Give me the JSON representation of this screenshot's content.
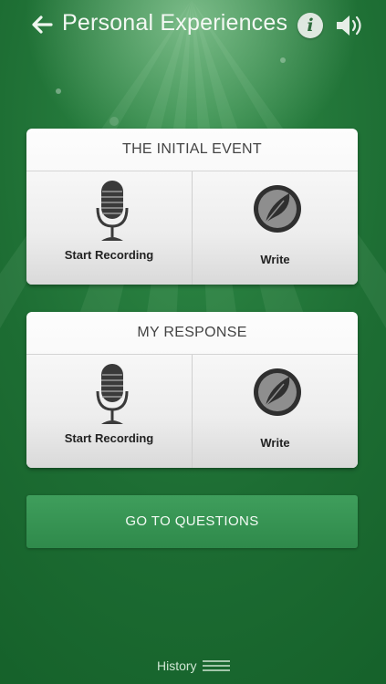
{
  "header": {
    "title": "Personal Experiences",
    "info_label": "i",
    "back_icon": "arrow-left-icon",
    "sound_icon": "speaker-icon"
  },
  "sections": [
    {
      "title": "THE INITIAL EVENT",
      "record_label": "Start Recording",
      "write_label": "Write"
    },
    {
      "title": "MY RESPONSE",
      "record_label": "Start Recording",
      "write_label": "Write"
    }
  ],
  "go_button": "GO TO QUESTIONS",
  "footer": {
    "history_label": "History",
    "menu_icon": "hamburger-icon"
  },
  "colors": {
    "background": "#1d6d33",
    "accent": "#3a9656",
    "card": "#f2f2f2",
    "icon": "#333333"
  }
}
